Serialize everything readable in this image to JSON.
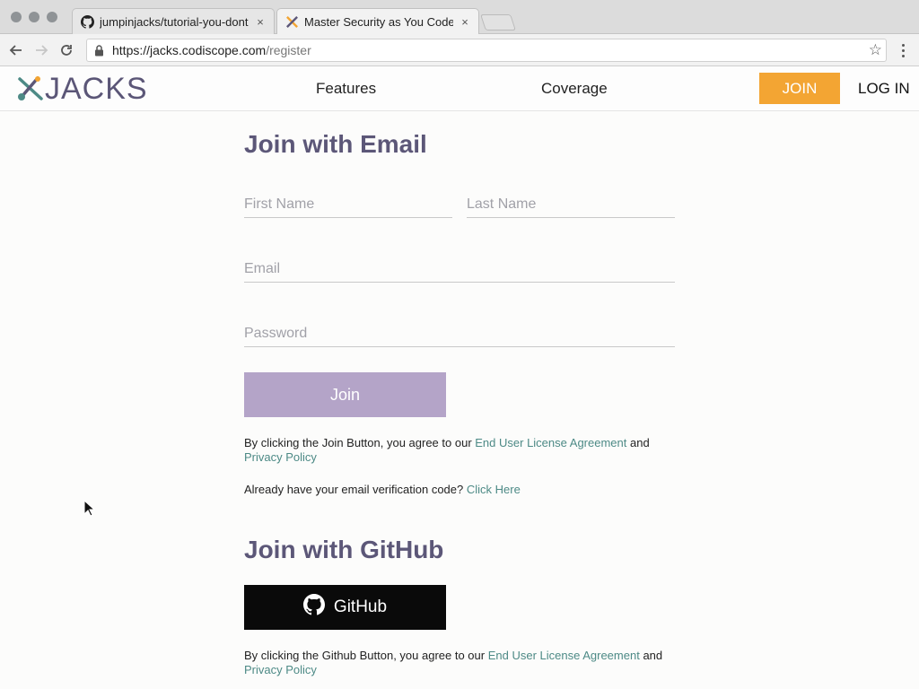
{
  "browser": {
    "tabs": [
      {
        "title": "jumpinjacks/tutorial-you-dont-",
        "icon": "github-icon",
        "active": false
      },
      {
        "title": "Master Security as You Code |",
        "icon": "jacks-favicon",
        "active": true
      }
    ],
    "close_glyph": "×",
    "url_host": "https://jacks.codiscope.com",
    "url_path": "/register"
  },
  "site": {
    "logo_text": "JACKS",
    "nav": {
      "features": "Features",
      "coverage": "Coverage"
    },
    "join_label": "JOIN",
    "login_label": "LOG IN",
    "colors": {
      "accent": "#f3a533",
      "brand": "#5c5778",
      "link": "#4d8a86",
      "join_disabled": "#b4a4c8"
    }
  },
  "email_form": {
    "heading": "Join with Email",
    "first_name_placeholder": "First Name",
    "last_name_placeholder": "Last Name",
    "email_placeholder": "Email",
    "password_placeholder": "Password",
    "join_button": "Join",
    "legal_prefix": "By clicking the Join Button, you agree to our ",
    "eula_link": "End User License Agreement",
    "legal_and": " and ",
    "privacy_link": "Privacy Policy",
    "verify_prefix": "Already have your email verification code? ",
    "verify_link": "Click Here"
  },
  "github_form": {
    "heading": "Join with GitHub",
    "button_label": "GitHub",
    "legal_prefix": "By clicking the Github Button, you agree to our ",
    "eula_link": "End User License Agreement",
    "legal_and": " and ",
    "privacy_link": "Privacy Policy"
  }
}
